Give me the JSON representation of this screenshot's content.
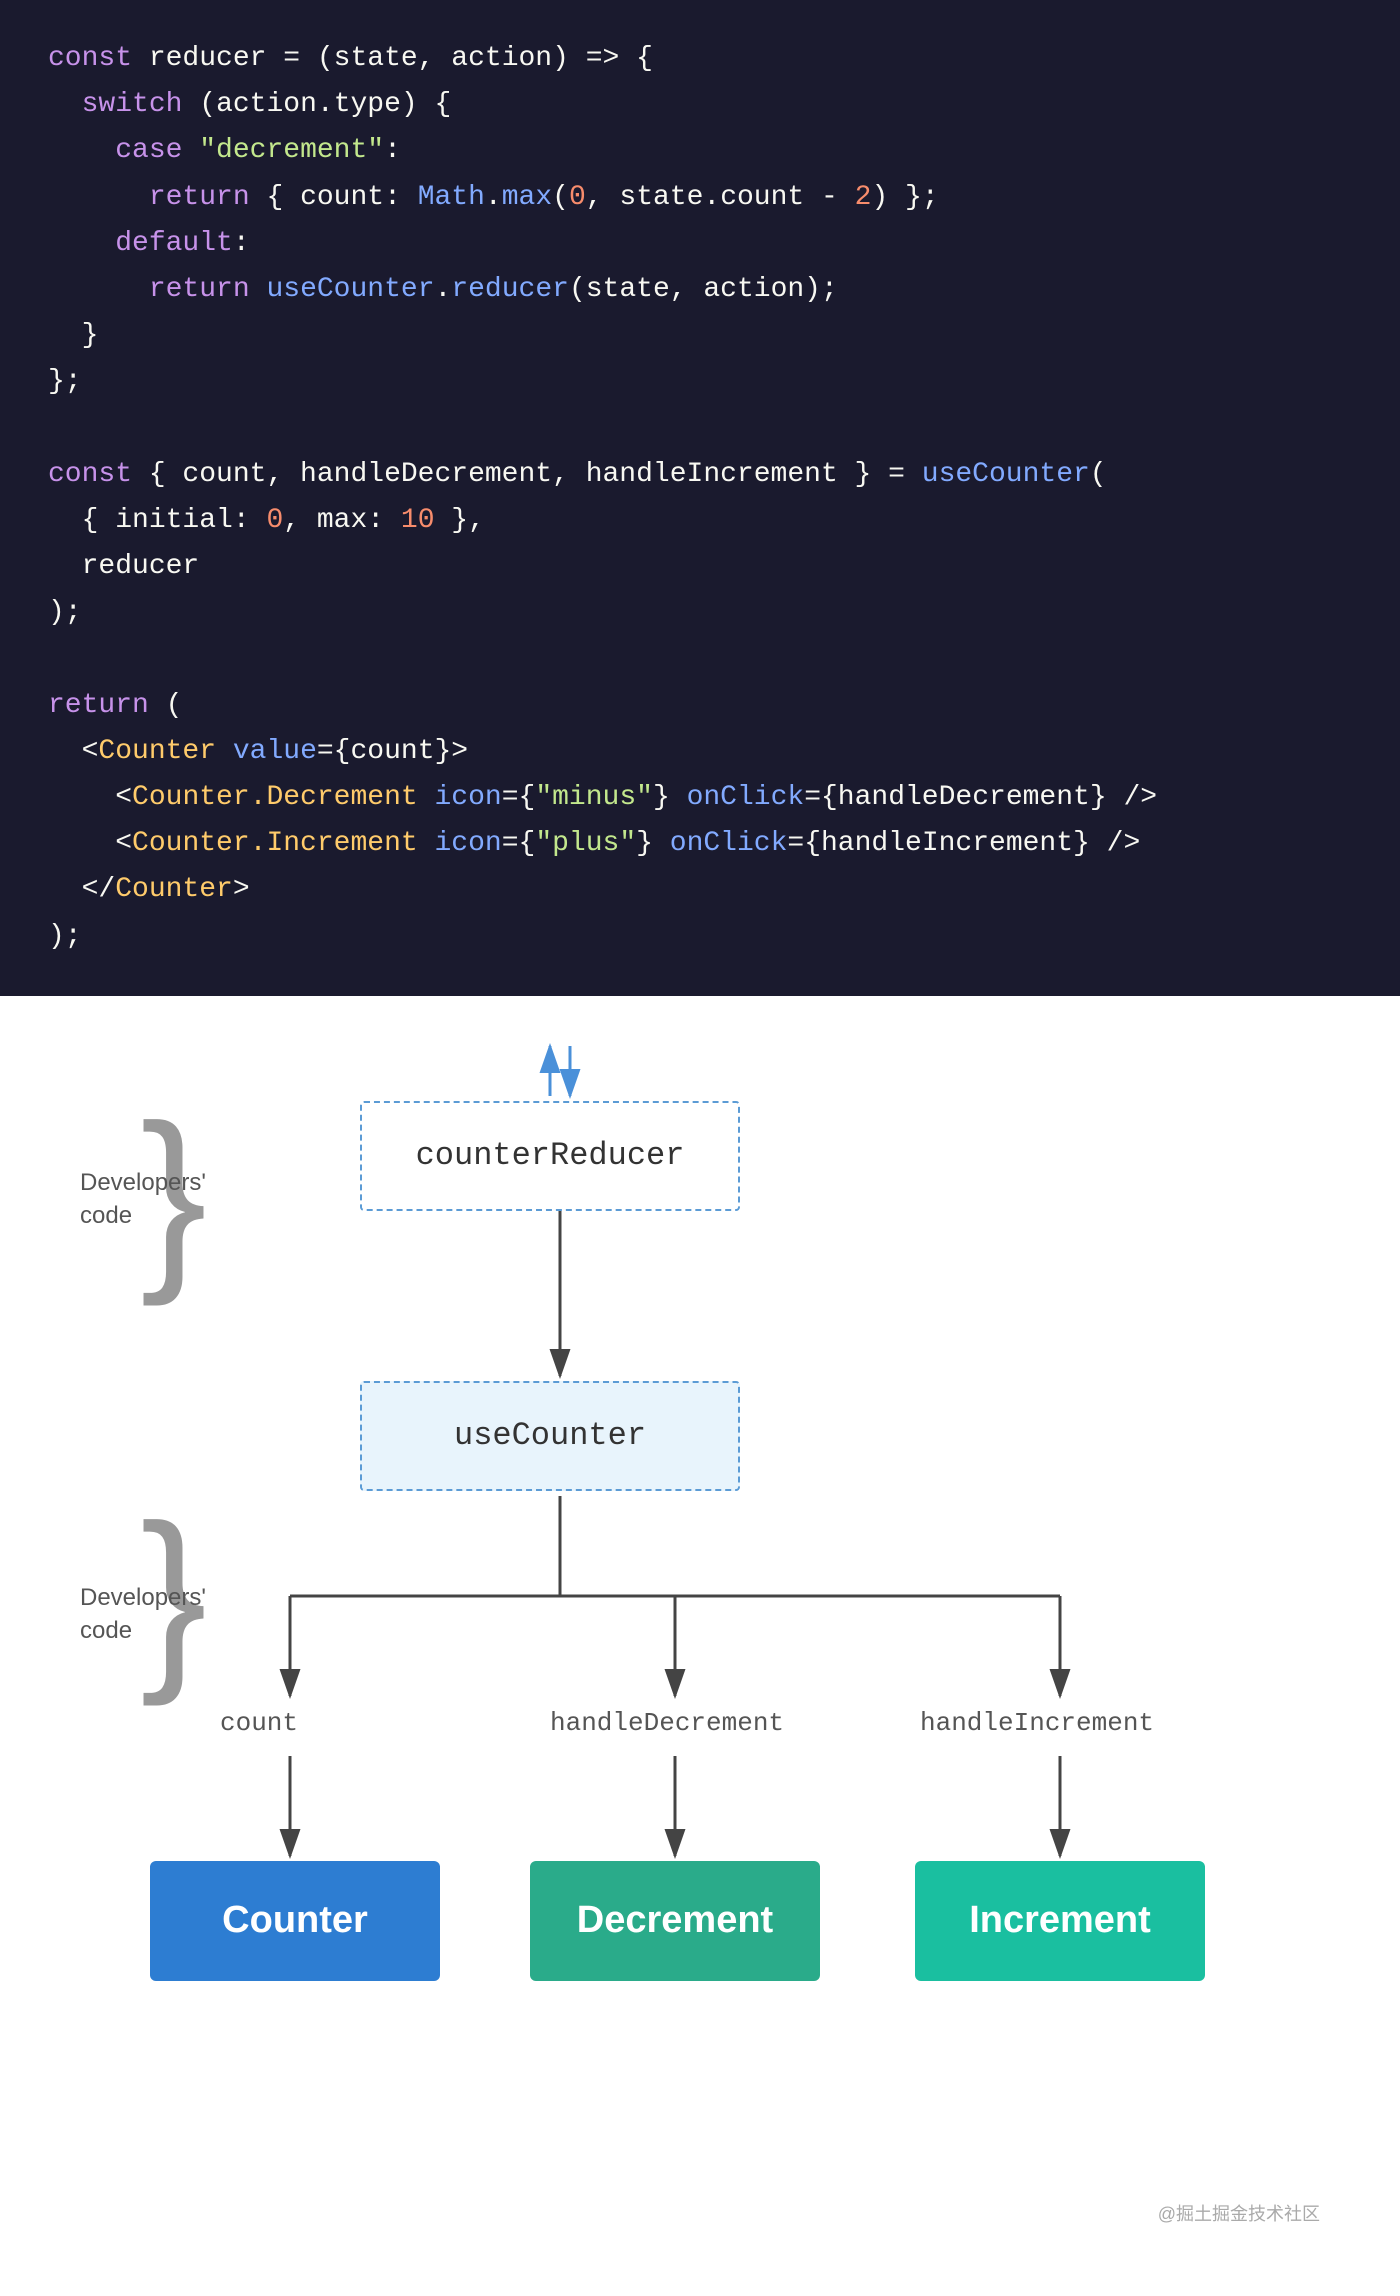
{
  "code": {
    "lines": [
      {
        "id": "l1",
        "text": "const reducer = (state, action) => {"
      },
      {
        "id": "l2",
        "text": "  switch (action.type) {"
      },
      {
        "id": "l3",
        "text": "    case \"decrement\":"
      },
      {
        "id": "l4",
        "text": "      return { count: Math.max(0, state.count - 2) };"
      },
      {
        "id": "l5",
        "text": "    default:"
      },
      {
        "id": "l6",
        "text": "      return useCounter.reducer(state, action);"
      },
      {
        "id": "l7",
        "text": "  }"
      },
      {
        "id": "l8",
        "text": "};"
      },
      {
        "id": "l9",
        "text": ""
      },
      {
        "id": "l10",
        "text": "const { count, handleDecrement, handleIncrement } = useCounter("
      },
      {
        "id": "l11",
        "text": "  { initial: 0, max: 10 },"
      },
      {
        "id": "l12",
        "text": "  reducer"
      },
      {
        "id": "l13",
        "text": ");"
      },
      {
        "id": "l14",
        "text": ""
      },
      {
        "id": "l15",
        "text": "return ("
      },
      {
        "id": "l16",
        "text": "  <Counter value={count}>"
      },
      {
        "id": "l17",
        "text": "    <Counter.Decrement icon={\"minus\"} onClick={handleDecrement} />"
      },
      {
        "id": "l18",
        "text": "    <Counter.Increment icon={\"plus\"} onClick={handleIncrement} />"
      },
      {
        "id": "l19",
        "text": "  </Counter>"
      },
      {
        "id": "l20",
        "text": ");"
      }
    ]
  },
  "diagram": {
    "counterReducer_label": "counterReducer",
    "useCounter_label": "useCounter",
    "developers_code_label1": "Developers'",
    "developers_code_label2": "code",
    "developers_code_label3": "Developers'",
    "developers_code_label4": "code",
    "count_label": "count",
    "handleDecrement_label": "handleDecrement",
    "handleIncrement_label": "handleIncrement",
    "counter_label": "Counter",
    "decrement_label": "Decrement",
    "increment_label": "Increment",
    "watermark": "@掘土掘金技术社区"
  }
}
